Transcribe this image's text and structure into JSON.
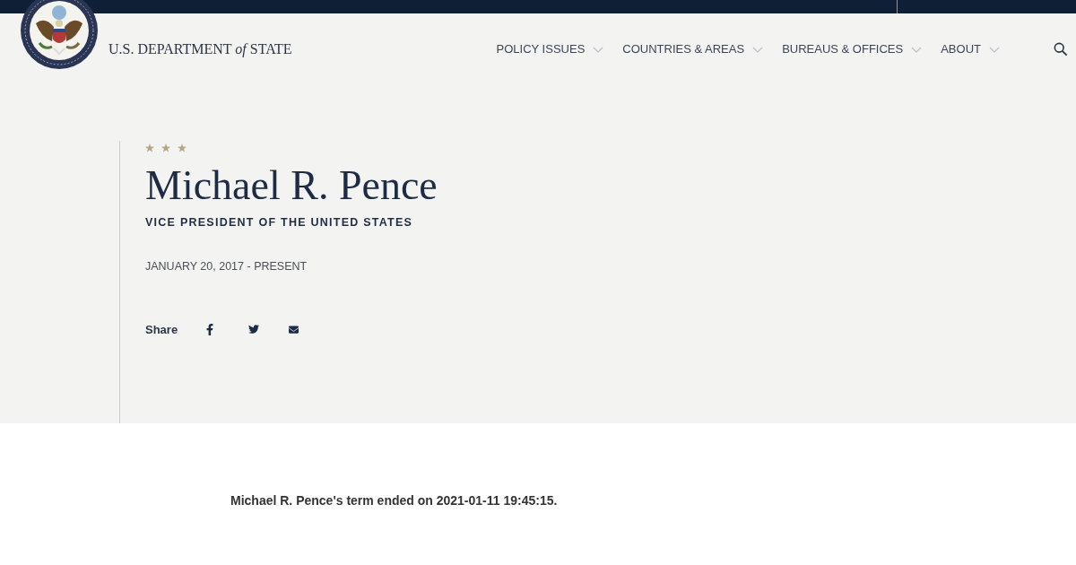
{
  "header": {
    "logo_text": "U.S. DEPARTMENT *of* STATE",
    "nav": [
      {
        "label": "POLICY ISSUES"
      },
      {
        "label": "COUNTRIES & AREAS"
      },
      {
        "label": "BUREAUS & OFFICES"
      },
      {
        "label": "ABOUT"
      }
    ]
  },
  "hero": {
    "name": "Michael R. Pence",
    "title": "VICE PRESIDENT OF THE UNITED STATES",
    "term": "JANUARY 20, 2017 - PRESENT",
    "share_label": "Share"
  },
  "notice": "Michael R. Pence's term ended on 2021-01-11 19:45:15."
}
